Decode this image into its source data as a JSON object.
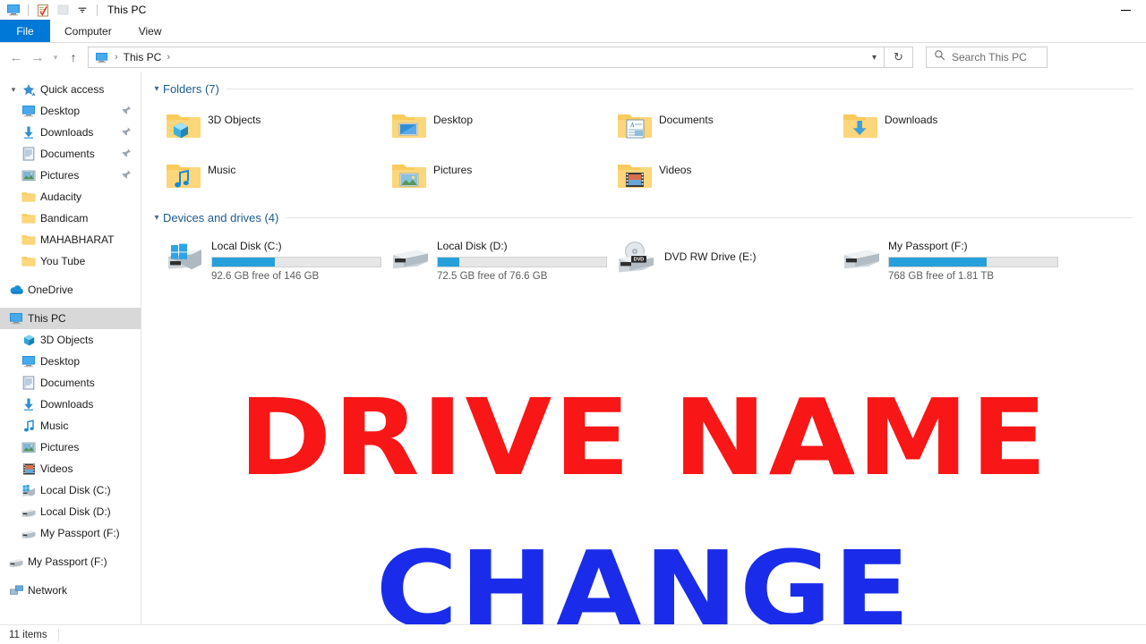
{
  "titlebar": {
    "title": "This PC",
    "quick_access": [
      {
        "name": "monitor-icon",
        "label": "This PC"
      },
      {
        "name": "properties-icon",
        "label": "Properties"
      },
      {
        "name": "new-folder-icon",
        "label": "New folder"
      },
      {
        "name": "customize-qat-icon",
        "label": "Customize Quick Access Toolbar"
      }
    ],
    "minimize_label": "Minimize"
  },
  "ribbon": {
    "tabs": [
      {
        "label": "File",
        "active": true
      },
      {
        "label": "Computer",
        "active": false
      },
      {
        "label": "View",
        "active": false
      }
    ]
  },
  "addressbar": {
    "back_label": "Back",
    "forward_label": "Forward",
    "recent_label": "Recent locations",
    "up_label": "Up",
    "breadcrumbs": [
      "This PC"
    ],
    "dropdown_label": "Previous locations",
    "refresh_label": "Refresh",
    "search_placeholder": "Search This PC"
  },
  "sidebar": {
    "items": [
      {
        "label": "Quick access",
        "icon": "star-icon",
        "level": 1,
        "chevron": true,
        "pinned": false,
        "selected": false
      },
      {
        "label": "Desktop",
        "icon": "desktop-icon",
        "level": 2,
        "chevron": false,
        "pinned": true,
        "selected": false
      },
      {
        "label": "Downloads",
        "icon": "downloads-icon",
        "level": 2,
        "chevron": false,
        "pinned": true,
        "selected": false
      },
      {
        "label": "Documents",
        "icon": "documents-icon",
        "level": 2,
        "chevron": false,
        "pinned": true,
        "selected": false
      },
      {
        "label": "Pictures",
        "icon": "pictures-icon",
        "level": 2,
        "chevron": false,
        "pinned": true,
        "selected": false
      },
      {
        "label": "Audacity",
        "icon": "folder-icon",
        "level": 2,
        "chevron": false,
        "pinned": false,
        "selected": false
      },
      {
        "label": "Bandicam",
        "icon": "folder-icon",
        "level": 2,
        "chevron": false,
        "pinned": false,
        "selected": false
      },
      {
        "label": "MAHABHARAT",
        "icon": "folder-icon",
        "level": 2,
        "chevron": false,
        "pinned": false,
        "selected": false
      },
      {
        "label": "You Tube",
        "icon": "folder-icon",
        "level": 2,
        "chevron": false,
        "pinned": false,
        "selected": false
      },
      {
        "label": "OneDrive",
        "icon": "onedrive-icon",
        "level": 1,
        "chevron": false,
        "pinned": false,
        "selected": false,
        "gap_before": true
      },
      {
        "label": "This PC",
        "icon": "monitor-icon",
        "level": 1,
        "chevron": false,
        "pinned": false,
        "selected": true,
        "gap_before": true
      },
      {
        "label": "3D Objects",
        "icon": "3dobjects-icon",
        "level": 2,
        "chevron": false,
        "pinned": false,
        "selected": false
      },
      {
        "label": "Desktop",
        "icon": "desktop-icon",
        "level": 2,
        "chevron": false,
        "pinned": false,
        "selected": false
      },
      {
        "label": "Documents",
        "icon": "documents-icon",
        "level": 2,
        "chevron": false,
        "pinned": false,
        "selected": false
      },
      {
        "label": "Downloads",
        "icon": "downloads-icon",
        "level": 2,
        "chevron": false,
        "pinned": false,
        "selected": false
      },
      {
        "label": "Music",
        "icon": "music-icon",
        "level": 2,
        "chevron": false,
        "pinned": false,
        "selected": false
      },
      {
        "label": "Pictures",
        "icon": "pictures-icon",
        "level": 2,
        "chevron": false,
        "pinned": false,
        "selected": false
      },
      {
        "label": "Videos",
        "icon": "videos-icon",
        "level": 2,
        "chevron": false,
        "pinned": false,
        "selected": false
      },
      {
        "label": "Local Disk (C:)",
        "icon": "windows-drive-icon",
        "level": 2,
        "chevron": false,
        "pinned": false,
        "selected": false
      },
      {
        "label": "Local Disk (D:)",
        "icon": "drive-icon",
        "level": 2,
        "chevron": false,
        "pinned": false,
        "selected": false
      },
      {
        "label": "My Passport (F:)",
        "icon": "drive-icon",
        "level": 2,
        "chevron": false,
        "pinned": false,
        "selected": false
      },
      {
        "label": "My Passport (F:)",
        "icon": "drive-icon",
        "level": 1,
        "chevron": false,
        "pinned": false,
        "selected": false,
        "gap_before": true
      },
      {
        "label": "Network",
        "icon": "network-icon",
        "level": 1,
        "chevron": false,
        "pinned": false,
        "selected": false,
        "gap_before": true
      }
    ]
  },
  "content": {
    "folders_group": {
      "title": "Folders (7)",
      "items": [
        {
          "label": "3D Objects",
          "icon": "folder-3dobjects-icon"
        },
        {
          "label": "Desktop",
          "icon": "folder-desktop-icon"
        },
        {
          "label": "Documents",
          "icon": "folder-documents-icon"
        },
        {
          "label": "Downloads",
          "icon": "folder-downloads-icon"
        },
        {
          "label": "Music",
          "icon": "folder-music-icon"
        },
        {
          "label": "Pictures",
          "icon": "folder-pictures-icon"
        },
        {
          "label": "Videos",
          "icon": "folder-videos-icon"
        }
      ]
    },
    "drives_group": {
      "title": "Devices and drives (4)",
      "items": [
        {
          "name": "Local Disk (C:)",
          "icon": "windows-drive-icon",
          "has_bar": true,
          "fill_percent": 37,
          "free_text": "92.6 GB free of 146 GB"
        },
        {
          "name": "Local Disk (D:)",
          "icon": "drive-icon",
          "has_bar": true,
          "fill_percent": 13,
          "free_text": "72.5 GB free of 76.6 GB"
        },
        {
          "name": "DVD RW Drive (E:)",
          "icon": "dvd-drive-icon",
          "has_bar": false,
          "fill_percent": 0,
          "free_text": ""
        },
        {
          "name": "My Passport (F:)",
          "icon": "drive-icon",
          "has_bar": true,
          "fill_percent": 58,
          "free_text": "768 GB free of 1.81 TB"
        }
      ]
    }
  },
  "overlay": {
    "line1": "DRIVE NAME",
    "line2": "CHANGE",
    "line1_color": "#f81616",
    "line2_color": "#1a2cea"
  },
  "statusbar": {
    "items_count": "11 items"
  },
  "colors": {
    "accent": "#0078d7",
    "bar_fill": "#26a0da",
    "group_title": "#1d5a8e",
    "selection": "#d8d8d8"
  }
}
